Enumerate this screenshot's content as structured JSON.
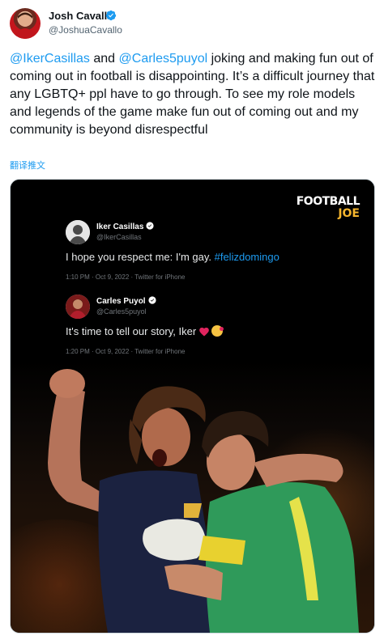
{
  "tweet": {
    "author_name": "Josh Cavallo",
    "author_handle": "@JoshuaCavallo",
    "mention_1": "@IkerCasillas",
    "text_1": " and ",
    "mention_2": "@Carles5puyol",
    "text_2": " joking and making fun out of coming out in football is disappointing. It’s a difficult journey that any LGBTQ+ ppl have to go through. To see my role models and legends of the game make fun out of coming out and my community is beyond disrespectful",
    "translate_label": "翻译推文"
  },
  "media": {
    "logo_line_1": "FOOTBALL",
    "logo_line_2": "JOE",
    "quoted_tweets": [
      {
        "name": "Iker Casillas",
        "handle": "@IkerCasillas",
        "text": "I hope you respect me: I'm gay. ",
        "hashtag": "#felizdomingo",
        "meta": "1:10 PM · Oct 9, 2022 · Twitter for iPhone"
      },
      {
        "name": "Carles Puyol",
        "handle": "@Carles5puyol",
        "text": "It's time to tell our story, Iker",
        "meta": "1:20 PM · Oct 9, 2022 · Twitter for iPhone"
      }
    ]
  },
  "colors": {
    "link": "#1d9bf0",
    "text": "#0f1419",
    "secondary": "#536471",
    "logo_accent": "#f5b52e",
    "verified": "#1d9bf0"
  },
  "icons": [
    "verified-badge-icon",
    "heart-icon",
    "kiss-emoji-icon"
  ]
}
